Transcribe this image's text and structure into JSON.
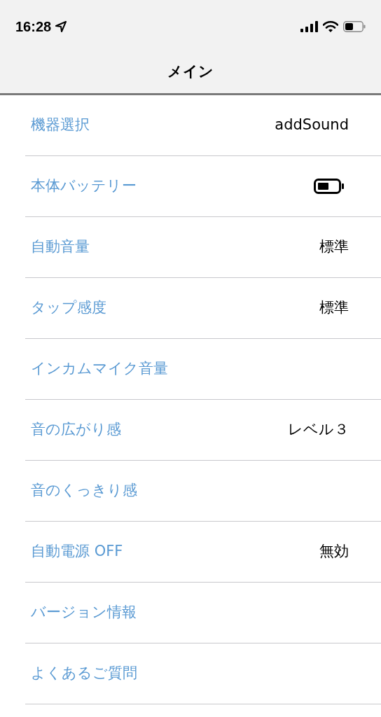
{
  "status_bar": {
    "time": "16:28"
  },
  "nav": {
    "title": "メイン"
  },
  "rows": [
    {
      "label": "機器選択",
      "kind": "text",
      "value": "addSound"
    },
    {
      "label": "本体バッテリー",
      "kind": "battery"
    },
    {
      "label": "自動音量",
      "kind": "text",
      "value": "標準"
    },
    {
      "label": "タップ感度",
      "kind": "text",
      "value": "標準"
    },
    {
      "label": "インカムマイク音量",
      "kind": "none"
    },
    {
      "label": "音の広がり感",
      "kind": "text",
      "value": "レベル３"
    },
    {
      "label": "音のくっきり感",
      "kind": "none"
    },
    {
      "label": "自動電源 OFF",
      "kind": "text",
      "value": "無効"
    },
    {
      "label": "バージョン情報",
      "kind": "none"
    },
    {
      "label": "よくあるご質問",
      "kind": "none"
    }
  ]
}
